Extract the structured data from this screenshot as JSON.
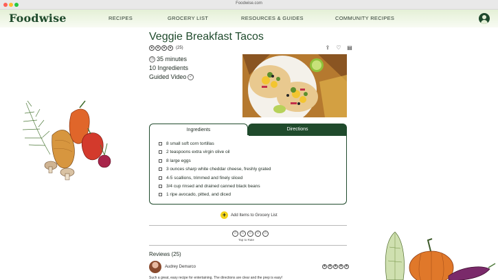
{
  "window": {
    "title": "Foodwise.com"
  },
  "nav": {
    "logo": "Foodwise",
    "links": [
      "RECIPES",
      "GROCERY LIST",
      "RESOURCES & GUIDES",
      "COMMUNITY RECIPES"
    ]
  },
  "recipe": {
    "title": "Veggie Breakfast Tacos",
    "rating_count": "(25)",
    "time": "35 minutes",
    "ingredient_count": "10 Ingredients",
    "guided_video": "Guided Video",
    "rating": 4
  },
  "tabs": {
    "ingredients": "Ingredients",
    "directions": "Directions",
    "active": "ingredients"
  },
  "ingredients": [
    "8 small soft corn tortillas",
    "2 teaspoons extra virgin olive oil",
    "8 large eggs",
    "3 ounces sharp white cheddar cheese, freshly grated",
    "4-5 scallions, trimmed and finely sliced",
    "3/4 cup rinsed and drained canned black beans",
    " 1 ripe avocado, pitted, and diced"
  ],
  "grocery": {
    "label": "Add Items to Grocery List"
  },
  "rate": {
    "label": "Tap to Rate"
  },
  "reviews": {
    "title": "Reviews (25)",
    "items": [
      {
        "author": "Audrey Demarco",
        "rating": 5,
        "text": "Such a great, easy recipe for entertaining. The directions are clear and the prep is easy!"
      }
    ]
  },
  "colors": {
    "brand": "#1f4a2c",
    "accent": "#f2d31b",
    "nav_bg": "#e4f0d6"
  }
}
